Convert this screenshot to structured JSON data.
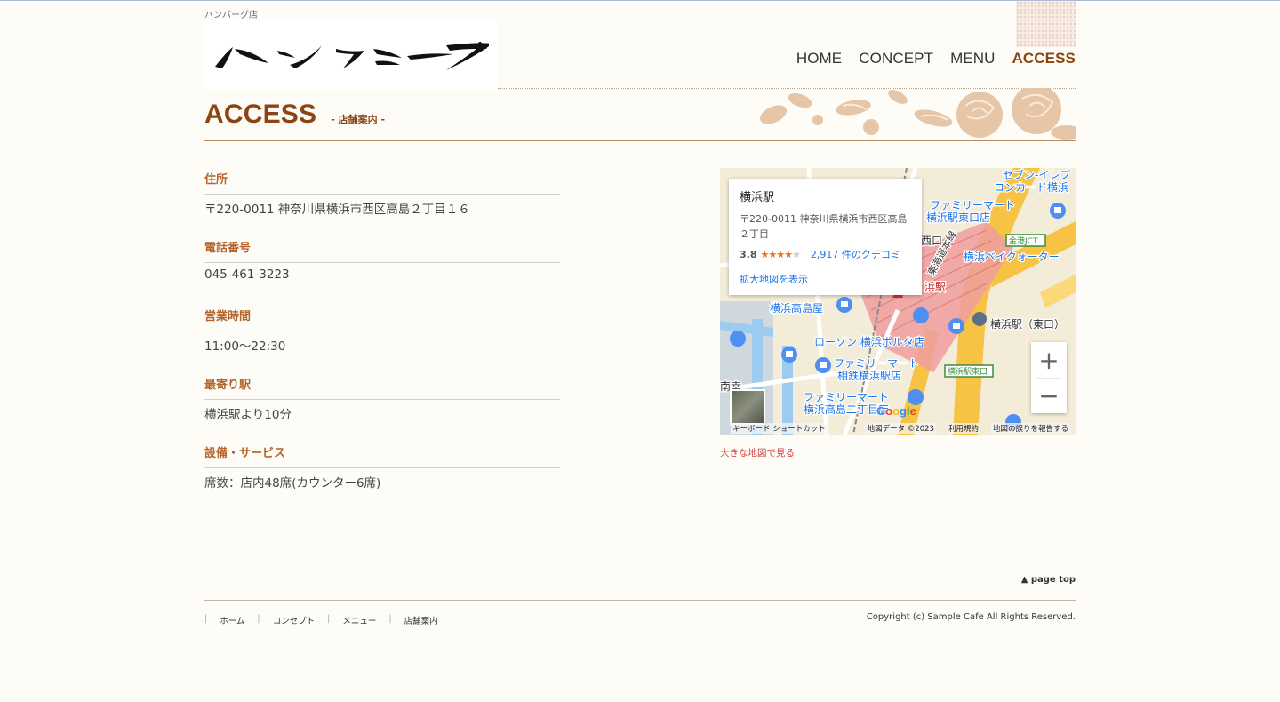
{
  "header": {
    "tagline": "ハンバーグ店",
    "logo_text": "ハンバーグ",
    "nav": [
      {
        "label": "HOME",
        "active": false
      },
      {
        "label": "CONCEPT",
        "active": false
      },
      {
        "label": "MENU",
        "active": false
      },
      {
        "label": "ACCESS",
        "active": true
      }
    ]
  },
  "page": {
    "title": "ACCESS",
    "subtitle": "- 店舗案内 -"
  },
  "info": [
    {
      "label": "住所",
      "value": "〒220-0011 神奈川県横浜市西区高島２丁目１６"
    },
    {
      "label": "電話番号",
      "value": "045-461-3223"
    },
    {
      "label": "営業時間",
      "value": "11:00〜22:30"
    },
    {
      "label": "最寄り駅",
      "value": "横浜駅より10分"
    },
    {
      "label": "設備・サービス",
      "value": "席数：店内48席(カウンター6席)"
    }
  ],
  "map": {
    "place_name": "横浜駅",
    "address": "〒220-0011 神奈川県横浜市西区高島２丁目",
    "rating": "3.8",
    "stars": 4,
    "reviews": "2,917 件のクチコミ",
    "larger_map": "拡大地図を表示",
    "zoom_in": "+",
    "zoom_out": "−",
    "brand": "Google",
    "footer": {
      "shortcuts": "キーボード ショートカット",
      "data": "地図データ ©2023",
      "terms": "利用規約",
      "report": "地図の誤りを報告する"
    },
    "labels": [
      "セブン-イレブ",
      "コンカード横浜",
      "ファミリーマート",
      "横浜駅東口店",
      "金港JCT",
      "横浜ベイクォーター",
      "西口",
      "東海道本線",
      "浜駅",
      "横浜高島屋",
      "横浜駅（東口）",
      "ローソン 横浜ポルタ店",
      "ファミリーマート",
      "相鉄横浜駅店",
      "横浜駅東口",
      "ファミリーマート",
      "横浜高島二丁目店",
      "南幸"
    ],
    "big_map_link": "大きな地図で見る",
    "colors": {
      "road": "#f6c344",
      "water": "#9ccbf0",
      "rail": "#ef8a8a",
      "poi": "#4f8ff2"
    }
  },
  "footer": {
    "page_top": "▲ page top",
    "links": [
      "ホーム",
      "コンセプト",
      "メニュー",
      "店舗案内"
    ],
    "copyright": "Copyright (c) Sample Cafe All Rights Reserved."
  }
}
